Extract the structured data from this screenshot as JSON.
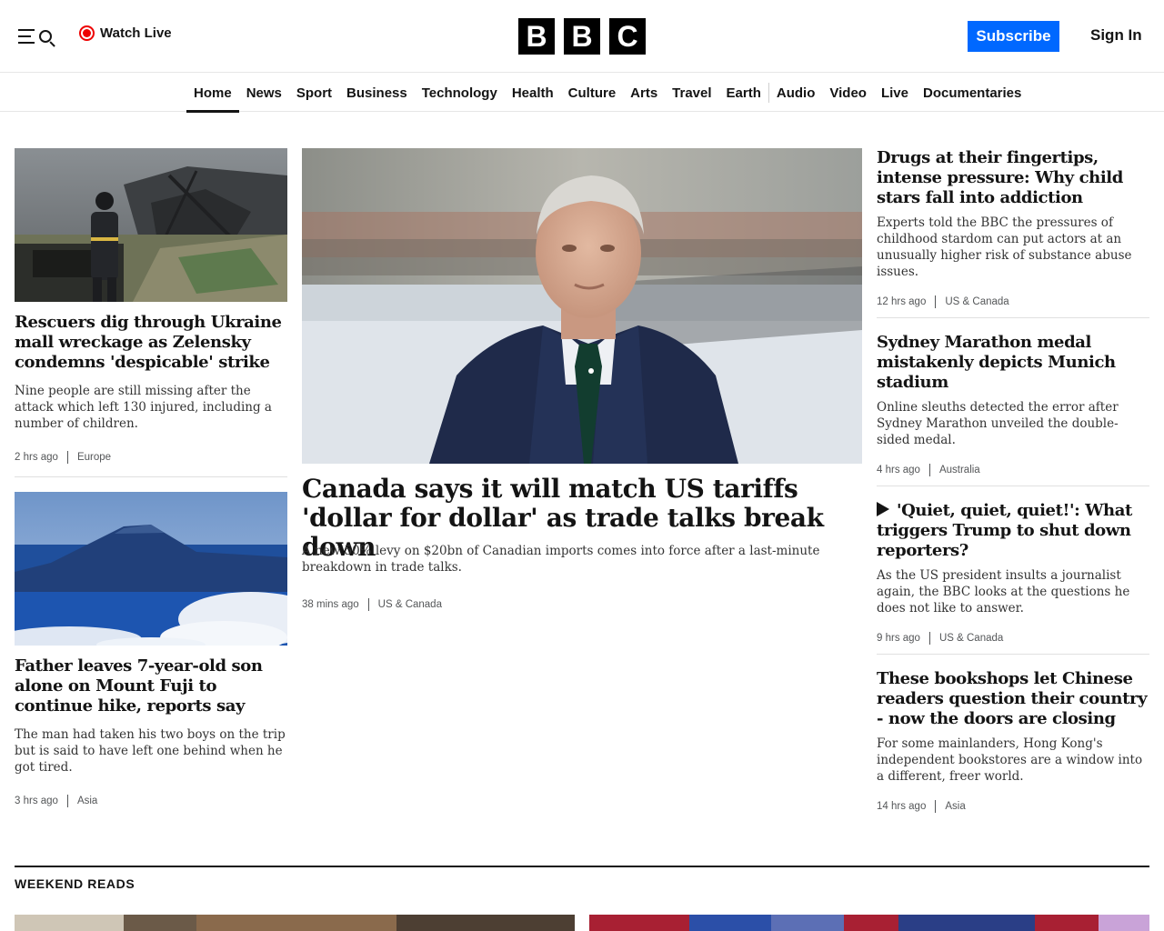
{
  "header": {
    "watch_live": "Watch Live",
    "logo_letters": [
      "B",
      "B",
      "C"
    ],
    "subscribe": "Subscribe",
    "sign_in": "Sign In"
  },
  "nav": {
    "items": [
      "Home",
      "News",
      "Sport",
      "Business",
      "Technology",
      "Health",
      "Culture",
      "Arts",
      "Travel",
      "Earth",
      "Audio",
      "Video",
      "Live",
      "Documentaries"
    ],
    "active": "Home"
  },
  "stories": {
    "left1": {
      "headline": "Rescuers dig through Ukraine mall wreckage as Zelensky condemns 'despicable' strike",
      "summary": "Nine people are still missing after the attack which left 130 injured, including a number of children.",
      "time": "2 hrs ago",
      "section": "Europe"
    },
    "left2": {
      "headline": "Father leaves 7-year-old son alone on Mount Fuji to continue hike, reports say",
      "summary": "The man had taken his two boys on the trip but is said to have left one behind when he got tired.",
      "time": "3 hrs ago",
      "section": "Asia"
    },
    "main": {
      "headline": "Canada says it will match US tariffs 'dollar for dollar' as trade talks break down",
      "summary": "A new 50% levy on $20bn of Canadian imports comes into force after a last-minute breakdown in trade talks.",
      "time": "38 mins ago",
      "section": "US & Canada"
    },
    "right1": {
      "headline": "Drugs at their fingertips, intense pressure: Why child stars fall into addiction",
      "summary": "Experts told the BBC the pressures of childhood stardom can put actors at an unusually higher risk of substance abuse issues.",
      "time": "12 hrs ago",
      "section": "US & Canada"
    },
    "right2": {
      "headline": "Sydney Marathon medal mistakenly depicts Munich stadium",
      "summary": "Online sleuths detected the error after Sydney Marathon unveiled the double-sided medal.",
      "time": "4 hrs ago",
      "section": "Australia"
    },
    "right3": {
      "headline": "'Quiet, quiet, quiet!': What triggers Trump to shut down reporters?",
      "summary": "As the US president insults a journalist again, the BBC looks at the questions he does not like to answer.",
      "time": "9 hrs ago",
      "section": "US & Canada"
    },
    "right4": {
      "headline": "These bookshops let Chinese readers question their country - now the doors are closing",
      "summary": "For some mainlanders, Hong Kong's independent bookstores are a window into a different, freer world.",
      "time": "14 hrs ago",
      "section": "Asia"
    }
  },
  "weekend": {
    "title": "WEEKEND READS"
  },
  "icons": {
    "menu": "menu-icon",
    "search": "search-icon",
    "live": "live-dot-icon",
    "play": "play-icon"
  },
  "colors": {
    "subscribe_bg": "#0068ff",
    "live_red": "#ee0000",
    "text": "#141414"
  }
}
